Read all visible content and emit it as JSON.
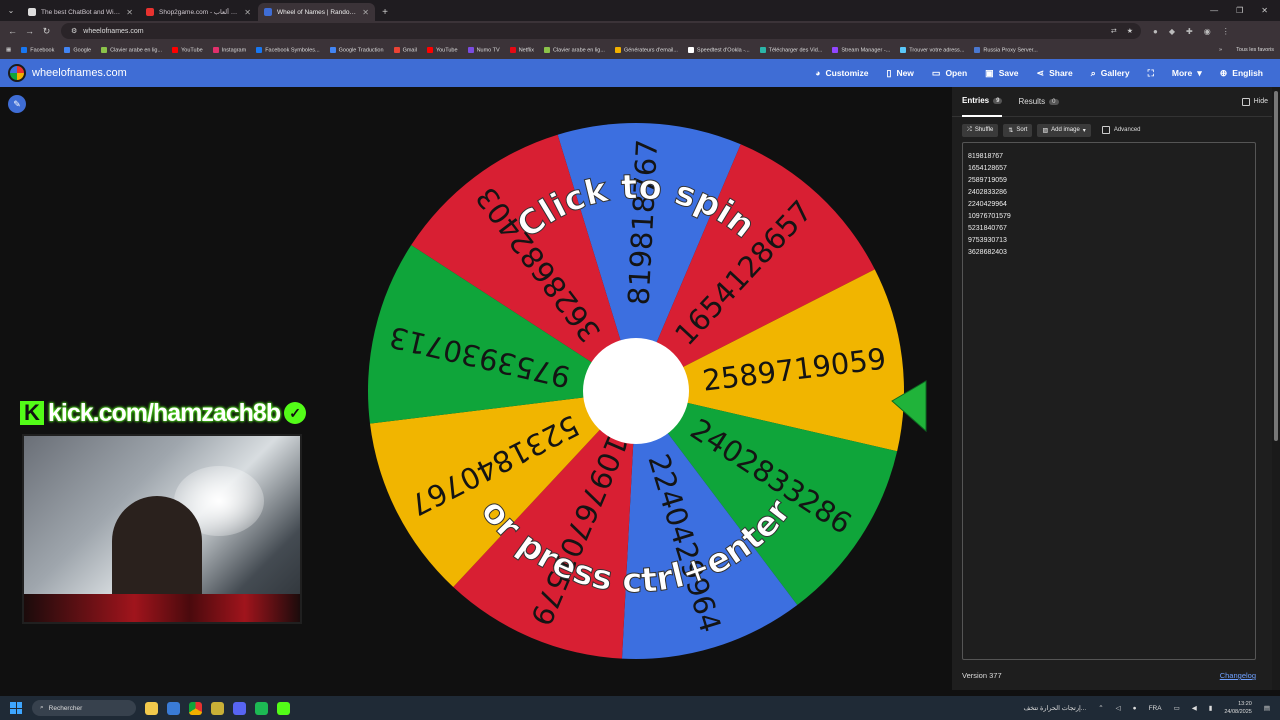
{
  "browser": {
    "tabs": [
      {
        "title": "The best ChatBot and Widgets...",
        "color": "#dddddd"
      },
      {
        "title": "Shop2game.com - شحن ألعاب ...",
        "color": "#e8322f"
      },
      {
        "title": "Wheel of Names | Random nam...",
        "color": "#3f6dd5"
      }
    ],
    "url": "wheelofnames.com",
    "bookmarks": [
      "Facebook",
      "Google",
      "Clavier arabe en lig...",
      "YouTube",
      "Instagram",
      "Facebook Symboles...",
      "Google Traduction",
      "Gmail",
      "YouTube",
      "Numo TV",
      "Netflix",
      "Clavier arabe en lig...",
      "Générateurs d'email...",
      "Speedtest d'Ookla -...",
      "Télécharger des Vid...",
      "Stream Manager -...",
      "Trouver votre adress...",
      "Russia Proxy Server..."
    ],
    "bookmarks_folder": "Tous les favoris"
  },
  "app": {
    "brand": "wheelofnames.com",
    "menu": {
      "customize": "Customize",
      "new": "New",
      "open": "Open",
      "save": "Save",
      "share": "Share",
      "gallery": "Gallery",
      "more": "More",
      "language": "English"
    }
  },
  "wheel": {
    "line1": "Click to spin",
    "line2": "or press ctrl+enter",
    "segments": [
      {
        "label": "819818767",
        "color": "#3c6fe0"
      },
      {
        "label": "1654128657",
        "color": "#d81f33"
      },
      {
        "label": "2589719059",
        "color": "#f1b500"
      },
      {
        "label": "2402833286",
        "color": "#0fa53a"
      },
      {
        "label": "2240429964",
        "color": "#3c6fe0"
      },
      {
        "label": "10976701579",
        "color": "#d81f33"
      },
      {
        "label": "5231840767",
        "color": "#f1b500"
      },
      {
        "label": "9753930713",
        "color": "#0fa53a"
      },
      {
        "label": "3628682403",
        "color": "#d81f33"
      }
    ]
  },
  "overlay": {
    "kick": "kick.com/hamzach8b"
  },
  "panel": {
    "tab_entries": "Entries",
    "entries_count": "9",
    "tab_results": "Results",
    "results_count": "0",
    "hide": "Hide",
    "shuffle": "Shuffle",
    "sort": "Sort",
    "add_image": "Add image",
    "advanced": "Advanced",
    "entries": [
      "819818767",
      "1654128657",
      "2589719059",
      "2402833286",
      "2240429964",
      "10976701579",
      "5231840767",
      "9753930713",
      "3628682403"
    ],
    "version": "Version 377",
    "changelog": "Changelog"
  },
  "taskbar": {
    "search": "Rechercher",
    "news": "إرتجات الحرارة تتخف...",
    "lang": "FRA",
    "time": "13:20",
    "date": "24/08/2025"
  }
}
